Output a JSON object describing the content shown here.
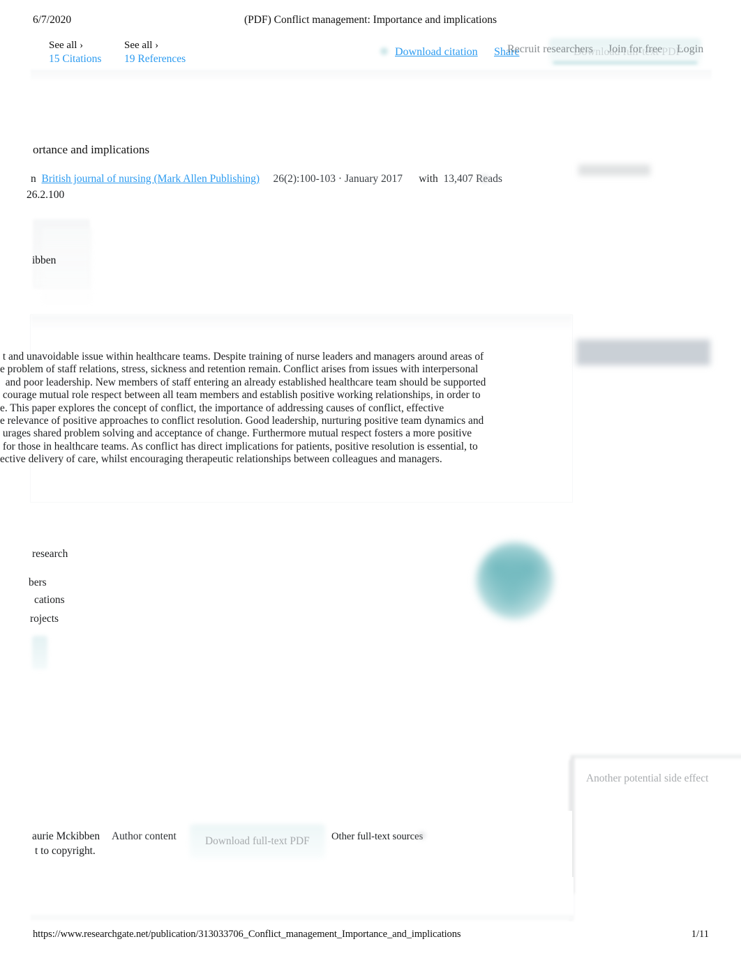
{
  "print_header": {
    "date": "6/7/2020",
    "title": "(PDF) Conflict management: Importance and implications"
  },
  "print_footer": {
    "url": "https://www.researchgate.net/publication/313033706_Conflict_management_Importance_and_implications",
    "page": "1/11"
  },
  "top_strip": {
    "citations": {
      "see_all": "See all ›",
      "count": "15",
      "label": "Citations"
    },
    "references": {
      "see_all": "See all ›",
      "count": "19",
      "label": "References"
    }
  },
  "header_actions": {
    "download_citation": "Download citation",
    "share": "Share",
    "recruit_researchers": "Recruit researchers",
    "join_for_free": "Join for free",
    "login": "Login",
    "download_full_text_pdf": "Download full-text PDF"
  },
  "publication": {
    "title_clipped": "ortance and implications",
    "meta_prefix": "n",
    "journal": "British journal of nursing (Mark Allen Publishing)",
    "volume_pages_date": "26(2):100-103 · January 2017",
    "with_label": "with",
    "reads": "13,407 Reads",
    "doi_clipped": "26.2.100",
    "author_clipped": "ibben"
  },
  "abstract": {
    "lines": [
      " t and unavoidable issue within healthcare teams. Despite training of nurse leaders and managers around areas of",
      "e problem of staff relations, stress, sickness and retention remain. Conflict arises from issues with interpersonal",
      "  and poor leadership. New members of staff entering an already established healthcare team should be supported",
      " courage mutual role respect between all team members and establish positive working relationships, in order to",
      "e. This paper explores the concept of conflict, the importance of addressing causes of conflict, effective",
      "e relevance of positive approaches to conflict resolution. Good leadership, nurturing positive team dynamics and",
      " urages shared problem solving and acceptance of change. Furthermore mutual respect fosters a more positive",
      " for those in healthcare teams. As conflict has direct implications for patients, positive resolution is essential, to",
      "ective delivery of care, whilst encouraging therapeutic relationships between colleagues and managers."
    ]
  },
  "discover": {
    "title_clipped": " research",
    "item_1_clipped": "bers",
    "item_2_clipped": " cations",
    "item_3_clipped": "rojects"
  },
  "bottom": {
    "author_clipped": "aurie Mckibben",
    "copyright_clipped": "t to copyright.",
    "author_content": "Author content",
    "download_full_text_pdf": "Download full-text PDF",
    "other_full_text_sources": "Other full-text sources"
  },
  "side_card": {
    "text": "Another potential side effect"
  },
  "colors": {
    "link_blue": "#2c9bf0",
    "text_black": "#111111",
    "ghost_grey": "#a9acaf",
    "teal": "#5aaeb4"
  }
}
